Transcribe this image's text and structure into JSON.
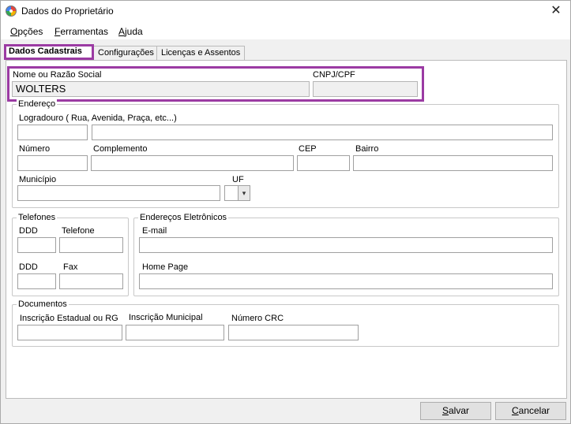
{
  "window": {
    "title": "Dados do Proprietário",
    "close_glyph": "✕"
  },
  "menu": [
    {
      "accel": "O",
      "rest": "pções"
    },
    {
      "accel": "F",
      "rest": "erramentas"
    },
    {
      "accel": "A",
      "rest": "juda"
    }
  ],
  "tabs": [
    "Dados Cadastrais",
    "Configurações",
    "Licenças e Assentos"
  ],
  "form": {
    "nome_label": "Nome ou Razão Social",
    "nome_value": "WOLTERS",
    "cnpj_label": "CNPJ/CPF",
    "cnpj_value": "",
    "endereco": {
      "legend": "Endereço",
      "logradouro_label": "Logradouro ( Rua, Avenida, Praça, etc...)",
      "numero_label": "Número",
      "complemento_label": "Complemento",
      "cep_label": "CEP",
      "bairro_label": "Bairro",
      "municipio_label": "Município",
      "uf_label": "UF"
    },
    "telefones": {
      "legend": "Telefones",
      "ddd1_label": "DDD",
      "telefone_label": "Telefone",
      "ddd2_label": "DDD",
      "fax_label": "Fax"
    },
    "eletronicos": {
      "legend": "Endereços Eletrônicos",
      "email_label": "E-mail",
      "homepage_label": "Home Page"
    },
    "documentos": {
      "legend": "Documentos",
      "ie_label": "Inscrição Estadual ou RG",
      "im_label": "Inscrição Municipal",
      "crc_label": "Número CRC"
    }
  },
  "buttons": {
    "salvar_accel": "S",
    "salvar_rest": "alvar",
    "cancelar_accel": "C",
    "cancelar_rest": "ancelar"
  },
  "icons": {
    "app": "app-logo-icon",
    "combo": "chevron-down-icon",
    "combo_glyph": "▾"
  }
}
